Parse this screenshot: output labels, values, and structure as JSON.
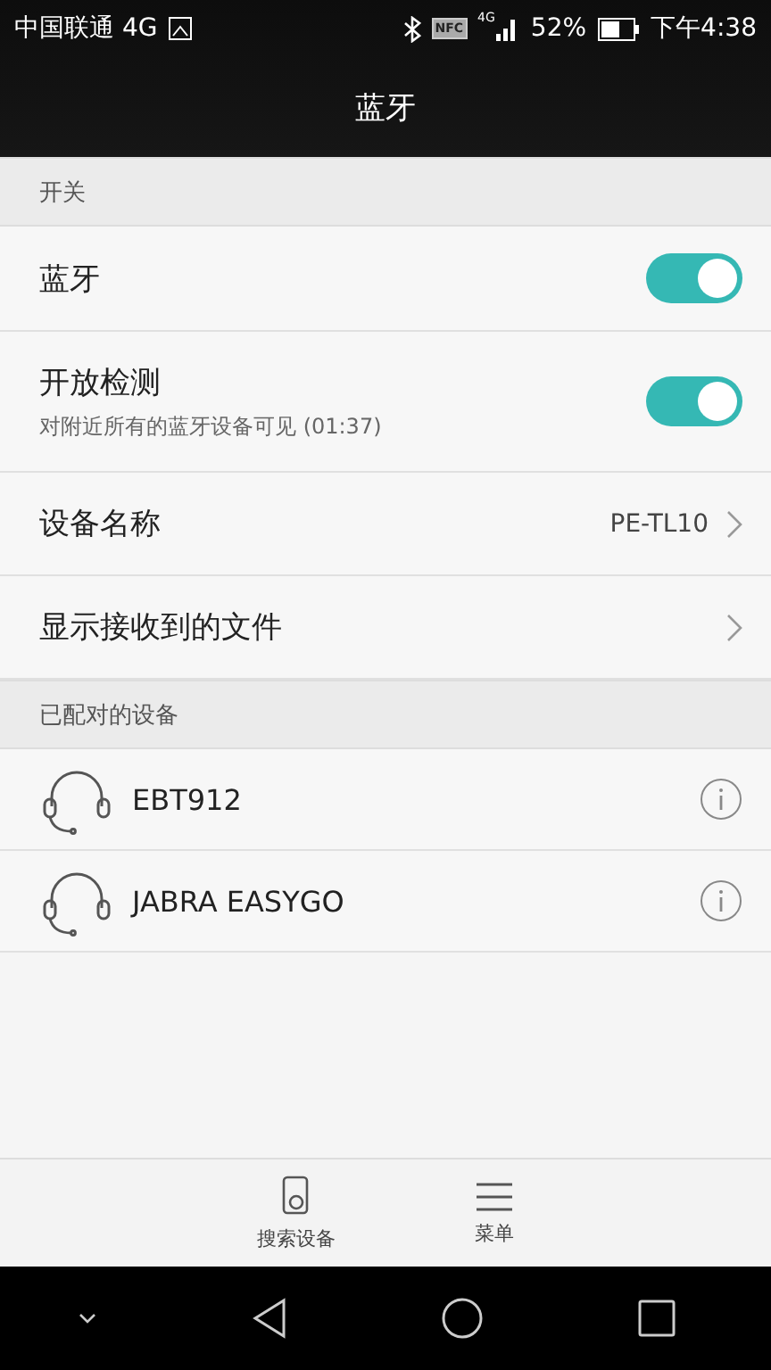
{
  "status_bar": {
    "carrier": "中国联通 4G",
    "network_label": "4G",
    "nfc": "NFC",
    "battery": "52%",
    "time": "下午4:38"
  },
  "title": "蓝牙",
  "sections": [
    {
      "header": "开关",
      "rows": [
        {
          "kind": "switch",
          "label": "蓝牙",
          "on": true
        },
        {
          "kind": "switch",
          "label": "开放检测",
          "subtitle": "对附近所有的蓝牙设备可见 (01:37)",
          "on": true
        },
        {
          "kind": "link",
          "label": "设备名称",
          "value": "PE-TL10"
        },
        {
          "kind": "link",
          "label": "显示接收到的文件"
        }
      ]
    },
    {
      "header": "已配对的设备",
      "rows": [
        {
          "kind": "device",
          "label": "EBT912"
        },
        {
          "kind": "device",
          "label": "JABRA EASYGO"
        }
      ]
    }
  ],
  "bottom_actions": [
    {
      "kind": "search",
      "label": "搜索设备"
    },
    {
      "kind": "menu",
      "label": "菜单"
    }
  ]
}
